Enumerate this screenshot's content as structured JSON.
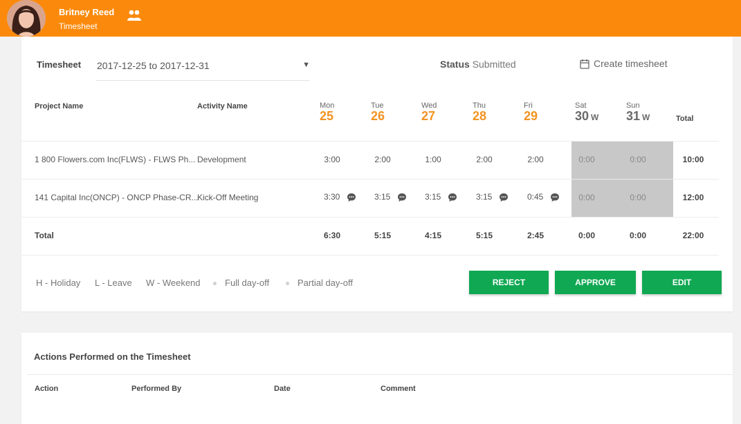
{
  "header": {
    "user_name": "Britney Reed",
    "subtitle": "Timesheet"
  },
  "timesheet": {
    "label": "Timesheet",
    "period": "2017-12-25 to 2017-12-31",
    "status_label": "Status",
    "status_value": "Submitted",
    "create_label": "Create timesheet"
  },
  "table": {
    "project_header": "Project Name",
    "activity_header": "Activity Name",
    "total_header": "Total",
    "days": [
      {
        "name": "Mon",
        "num": "25",
        "w": ""
      },
      {
        "name": "Tue",
        "num": "26",
        "w": ""
      },
      {
        "name": "Wed",
        "num": "27",
        "w": ""
      },
      {
        "name": "Thu",
        "num": "28",
        "w": ""
      },
      {
        "name": "Fri",
        "num": "29",
        "w": ""
      },
      {
        "name": "Sat",
        "num": "30",
        "w": "W"
      },
      {
        "name": "Sun",
        "num": "31",
        "w": "W"
      }
    ],
    "rows": [
      {
        "project": "1 800 Flowers.com Inc(FLWS) - FLWS Ph...",
        "activity": "Development",
        "hours": [
          "3:00",
          "2:00",
          "1:00",
          "2:00",
          "2:00",
          "0:00",
          "0:00"
        ],
        "total": "10:00"
      },
      {
        "project": "141 Capital Inc(ONCP) - ONCP Phase-CR...",
        "activity": "Kick-Off Meeting",
        "hours": [
          "3:30",
          "3:15",
          "3:15",
          "3:15",
          "0:45",
          "0:00",
          "0:00"
        ],
        "total": "12:00"
      }
    ],
    "totals_label": "Total",
    "totals": [
      "6:30",
      "5:15",
      "4:15",
      "5:15",
      "2:45",
      "0:00",
      "0:00"
    ],
    "grand_total": "22:00"
  },
  "legend": {
    "holiday": "H - Holiday",
    "leave": "L - Leave",
    "weekend": "W - Weekend",
    "full_day_off": "Full day-off",
    "partial_day_off": "Partial day-off"
  },
  "buttons": {
    "reject": "REJECT",
    "approve": "APPROVE",
    "edit": "EDIT"
  },
  "actions": {
    "title": "Actions Performed on the Timesheet",
    "columns": [
      "Action",
      "Performed By",
      "Date",
      "Comment"
    ]
  },
  "colors": {
    "topbar": "#fb8a0c",
    "accent_day": "#f39322",
    "button": "#10a853",
    "weekend_shade": "#c8c8c8"
  }
}
